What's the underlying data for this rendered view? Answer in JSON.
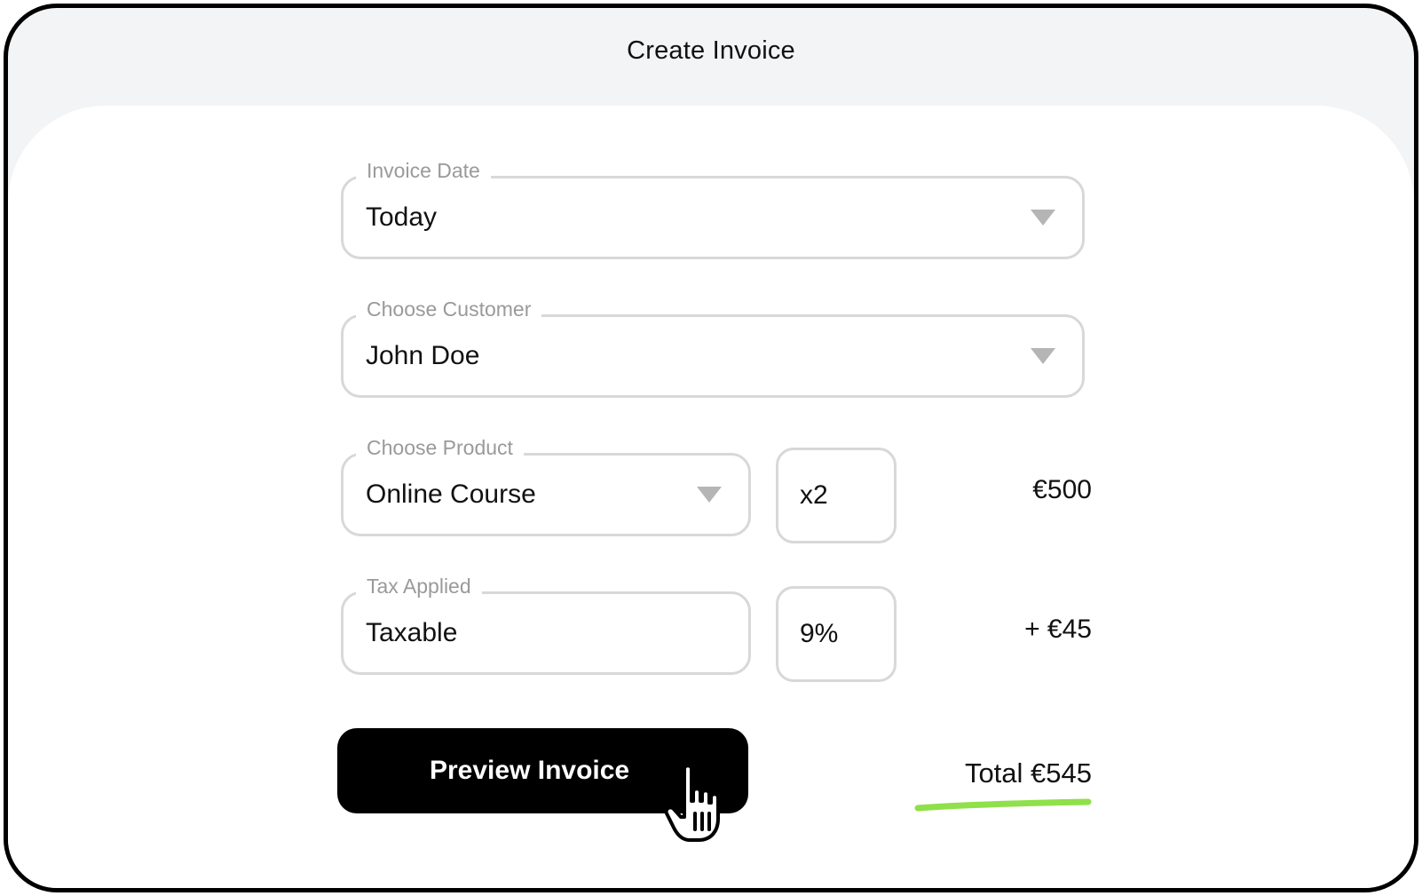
{
  "header": {
    "title": "Create Invoice"
  },
  "form": {
    "invoice_date": {
      "label": "Invoice Date",
      "value": "Today"
    },
    "customer": {
      "label": "Choose Customer",
      "value": "John Doe"
    },
    "product": {
      "label": "Choose Product",
      "value": "Online Course",
      "quantity": "x2",
      "amount": "€500"
    },
    "tax": {
      "label": "Tax Applied",
      "value": "Taxable",
      "rate": "9%",
      "amount": "+ €45"
    }
  },
  "actions": {
    "preview_label": "Preview Invoice"
  },
  "summary": {
    "total": "Total €545"
  },
  "colors": {
    "accent_underline": "#8fe04a",
    "button_bg": "#000000",
    "field_border": "#d8d8d8"
  },
  "icons": {
    "dropdown": "caret-down-icon",
    "cursor": "pointer-hand-icon"
  }
}
